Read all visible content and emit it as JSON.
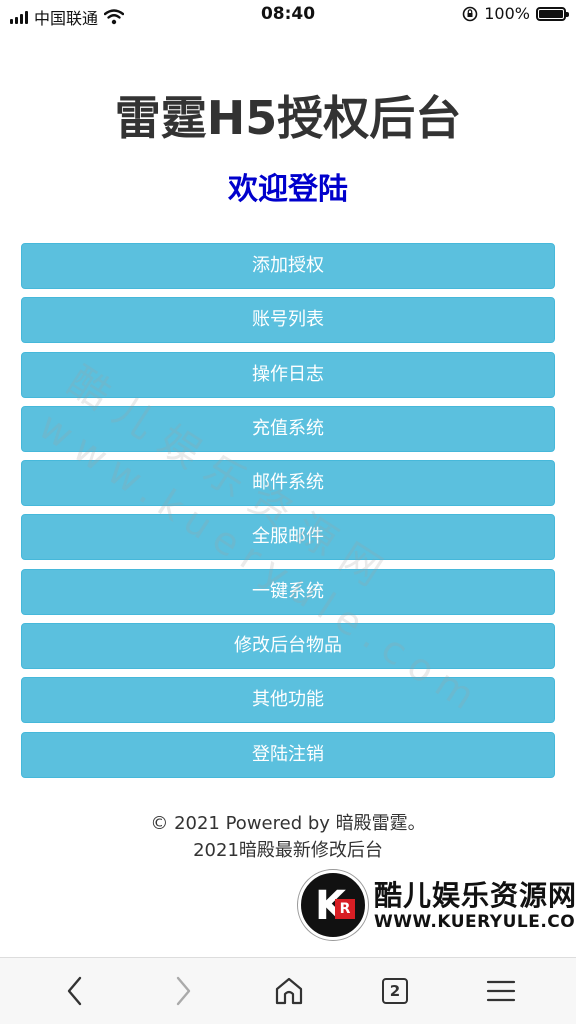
{
  "status_bar": {
    "carrier": "中国联通",
    "time": "08:40",
    "battery": "100%",
    "battery_level": 1.0
  },
  "header": {
    "title": "雷霆H5授权后台",
    "subtitle": "欢迎登陆"
  },
  "menu": [
    {
      "label": "添加授权"
    },
    {
      "label": "账号列表"
    },
    {
      "label": "操作日志"
    },
    {
      "label": "充值系统"
    },
    {
      "label": "邮件系统"
    },
    {
      "label": "全服邮件"
    },
    {
      "label": "一键系统"
    },
    {
      "label": "修改后台物品"
    },
    {
      "label": "其他功能"
    },
    {
      "label": "登陆注销"
    }
  ],
  "watermark": {
    "line1": "酷儿娱乐资源网",
    "line2": "www.kueryule.com"
  },
  "footer": {
    "line1": "© 2021 Powered by 暗殿雷霆。",
    "line2": "2021暗殿最新修改后台"
  },
  "logo": {
    "text_cn": "酷儿娱乐资源网",
    "text_en": "WWW.KUERYULE.COM"
  },
  "browser_nav": {
    "tab_count": "2"
  },
  "colors": {
    "button_bg": "#5bc0de",
    "subtitle": "#0000cc",
    "logo_red": "#d81e24"
  }
}
